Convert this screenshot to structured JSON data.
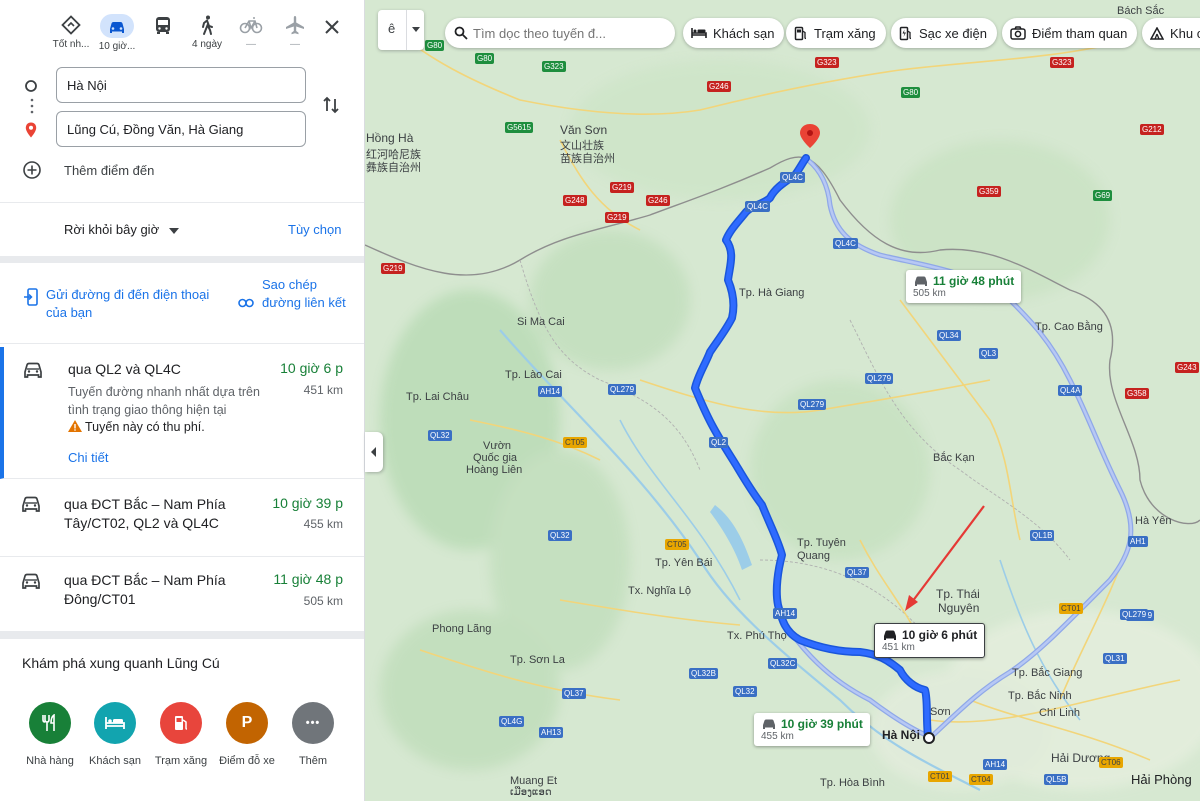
{
  "travel_modes": [
    {
      "icon": "best-route-icon",
      "label": "Tốt nh..."
    },
    {
      "icon": "car-icon",
      "label": "10 giờ...",
      "selected": true
    },
    {
      "icon": "bus-icon",
      "label": ""
    },
    {
      "icon": "walk-icon",
      "label": "4 ngày"
    },
    {
      "icon": "bicycle-icon",
      "label": "—"
    },
    {
      "icon": "plane-icon",
      "label": "—"
    }
  ],
  "waypoints": {
    "origin": "Hà Nội",
    "destination": "Lũng Cú, Đồng Văn, Hà Giang",
    "add_label": "Thêm điểm đến"
  },
  "depart": {
    "label": "Rời khỏi bây giờ",
    "options_label": "Tùy chọn"
  },
  "share": {
    "send_label": "Gửi đường đi đến điện thoại của bạn",
    "copy_label": "Sao chép đường liên kết"
  },
  "routes": [
    {
      "name": "qua QL2 và QL4C",
      "time": "10 giờ 6 p",
      "distance": "451 km",
      "desc": "Tuyến đường nhanh nhất dựa trên tình trạng giao thông hiện tại",
      "toll": "Tuyến này có thu phí.",
      "details_label": "Chi tiết"
    },
    {
      "name": "qua ĐCT Bắc – Nam Phía Tây/CT02, QL2 và QL4C",
      "time": "10 giờ 39 p",
      "distance": "455 km"
    },
    {
      "name": "qua ĐCT Bắc – Nam Phía Đông/CT01",
      "time": "11 giờ 48 p",
      "distance": "505 km"
    }
  ],
  "explore": {
    "title": "Khám phá xung quanh Lũng Cú",
    "items": [
      {
        "label": "Nhà hàng",
        "icon": "restaurant-icon",
        "color": "#188038"
      },
      {
        "label": "Khách sạn",
        "icon": "hotel-icon",
        "color": "#12a4af"
      },
      {
        "label": "Trạm xăng",
        "icon": "gas-station-icon",
        "color": "#e8453c"
      },
      {
        "label": "Điểm đỗ xe",
        "icon": "parking-icon",
        "color": "#c26401",
        "glyph": "P"
      },
      {
        "label": "Thêm",
        "icon": "more-icon",
        "color": "#70757a",
        "glyph": "•••"
      }
    ]
  },
  "map": {
    "lang_label": "ê",
    "search_placeholder": "Tìm dọc theo tuyến đ...",
    "chips": [
      {
        "label": "Khách sạn",
        "icon": "hotel-icon"
      },
      {
        "label": "Trạm xăng",
        "icon": "gas-station-icon"
      },
      {
        "label": "Sạc xe điện",
        "icon": "ev-charger-icon"
      },
      {
        "label": "Điểm tham quan",
        "icon": "camera-icon"
      },
      {
        "label": "Khu c",
        "icon": "campground-icon"
      }
    ],
    "bubbles": [
      {
        "time": "10 giờ 6 phút",
        "distance": "451 km"
      },
      {
        "time": "10 giờ 39 phút",
        "distance": "455 km"
      },
      {
        "time": "11 giờ 48 phút",
        "distance": "505 km"
      }
    ],
    "place_labels": [
      "Bách Sắc",
      "Hồng Hà",
      "红河哈尼族",
      "彝族自治州",
      "Văn Sơn",
      "文山壮族",
      "苗族自治州",
      "Tp. Hà Giang",
      "Si Ma Cai",
      "Tp. Cao Bằng",
      "Tp. Lào Cai",
      "Tp. Lai Châu",
      "Vườn",
      "Quốc gia",
      "Hoàng Liên",
      "Bắc Kạn",
      "Tp. Tuyên",
      "Quang",
      "Tp. Yên Bái",
      "Tx. Nghĩa Lộ",
      "Tp. Thái",
      "Nguyên",
      "Phong Lãng",
      "Tx. Phú Thọ",
      "Tp. Sơn La",
      "Tp. Bắc Giang",
      "Tp. Bắc Ninh",
      "Chí Linh",
      "Hà Nội",
      "Hải Dương",
      "Hải Phòng",
      "Muang Et",
      "ເມືອງແອດ",
      "Tp. Hòa Bình",
      "Hà Yên",
      "Sơn"
    ],
    "road_shields": [
      "G80",
      "G80",
      "G323",
      "G323",
      "G323",
      "G246",
      "G80",
      "G5615",
      "G219",
      "G219",
      "G248",
      "G246",
      "G219",
      "G212",
      "G359",
      "G69",
      "QL4C",
      "QL4C",
      "QL4C",
      "QL34",
      "QL3",
      "QL279",
      "QL279",
      "QL279",
      "QL4A",
      "QL2",
      "AH14",
      "QL32",
      "CT05",
      "QL32",
      "CT05",
      "QL37",
      "QL1B",
      "QL279",
      "AH14",
      "QL32C",
      "QL32B",
      "QL32",
      "QL37",
      "QL4G",
      "AH13",
      "CT01",
      "QL31",
      "AH1",
      "CT01",
      "CT04",
      "AH14",
      "QL5B",
      "CT06",
      "G243",
      "G358",
      "QL279"
    ]
  }
}
